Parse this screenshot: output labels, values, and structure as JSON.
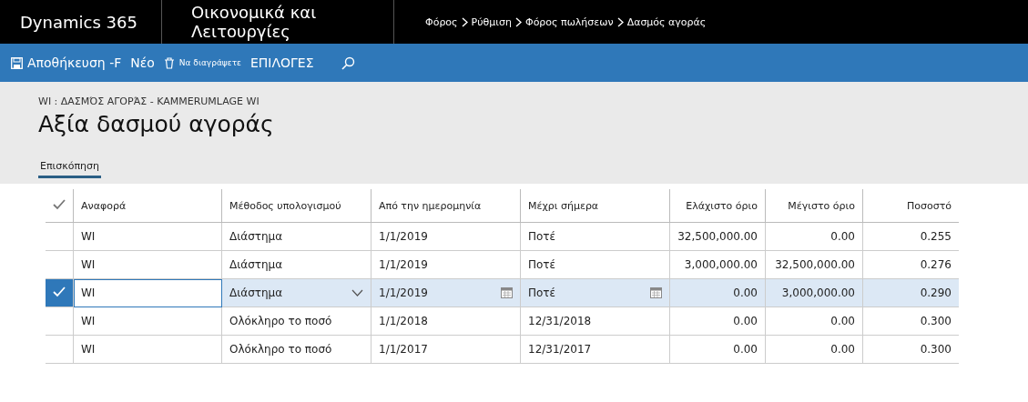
{
  "nav_bar": {
    "app_name": "Dynamics 365",
    "module": "Οικονομικά και Λειτουργίες",
    "breadcrumb": [
      "Φόρος",
      "Ρύθμιση",
      "Φόρος πωλήσεων",
      "Δασμός αγοράς"
    ]
  },
  "toolbar": {
    "save": "Αποθήκευση -F",
    "new": "Νέο",
    "delete": "Να διαγράψετε",
    "options": "ΕΠΙΛΟΓΕΣ"
  },
  "page": {
    "caption": "WI : ΔΑΣΜΌΣ ΑΓΟΡΆΣ - KAMMERUMLAGE WI",
    "title": "Αξία δασμού αγοράς",
    "tabs": [
      {
        "label": "Επισκόπηση",
        "selected": true
      }
    ]
  },
  "table": {
    "columns": [
      "Αναφορά",
      "Μέθοδος υπολογισμού",
      "Από την ημερομηνία",
      "Μέχρι σήμερα",
      "Ελάχιστο όριο",
      "Μέγιστο όριο",
      "Ποσοστό"
    ],
    "rows": [
      {
        "selected": false,
        "cells": [
          "WI",
          "Διάστημα",
          "1/1/2019",
          "Ποτέ",
          "32,500,000.00",
          "0.00",
          "0.255"
        ]
      },
      {
        "selected": false,
        "cells": [
          "WI",
          "Διάστημα",
          "1/1/2019",
          "Ποτέ",
          "3,000,000.00",
          "32,500,000.00",
          "0.276"
        ]
      },
      {
        "selected": true,
        "cells": [
          "WI",
          "Διάστημα",
          "1/1/2019",
          "Ποτέ",
          "0.00",
          "3,000,000.00",
          "0.290"
        ]
      },
      {
        "selected": false,
        "cells": [
          "WI",
          "Ολόκληρο το ποσό",
          "1/1/2018",
          "12/31/2018",
          "0.00",
          "0.00",
          "0.300"
        ]
      },
      {
        "selected": false,
        "cells": [
          "WI",
          "Ολόκληρο το ποσό",
          "1/1/2017",
          "12/31/2017",
          "0.00",
          "0.00",
          "0.300"
        ]
      }
    ]
  }
}
